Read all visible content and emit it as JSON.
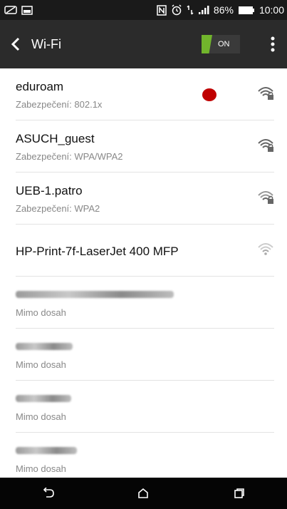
{
  "status_bar": {
    "battery_percent": "86%",
    "time": "10:00",
    "icons": [
      "sync-icon",
      "image-icon",
      "nfc-icon",
      "alarm-icon",
      "data-icon",
      "signal-icon",
      "battery-icon"
    ]
  },
  "action_bar": {
    "title": "Wi-Fi",
    "toggle_label": "ON",
    "toggle_color": "#71b52c"
  },
  "networks": [
    {
      "name": "eduroam",
      "security": "Zabezpečení: 802.1x",
      "secured": true
    },
    {
      "name": "ASUCH_guest",
      "security": "Zabezpečení: WPA/WPA2",
      "secured": true
    },
    {
      "name": "UEB-1.patro",
      "security": "Zabezpečení: WPA2",
      "secured": true
    },
    {
      "name": "HP-Print-7f-LaserJet 400 MFP",
      "security": "",
      "secured": false
    },
    {
      "status": "Mimo dosah"
    },
    {
      "status": "Mimo dosah"
    },
    {
      "status": "Mimo dosah"
    },
    {
      "status": "Mimo dosah"
    }
  ],
  "annotation_color": "#c00000",
  "nav_bar": {
    "icons": [
      "back-icon",
      "home-icon",
      "recents-icon"
    ]
  }
}
